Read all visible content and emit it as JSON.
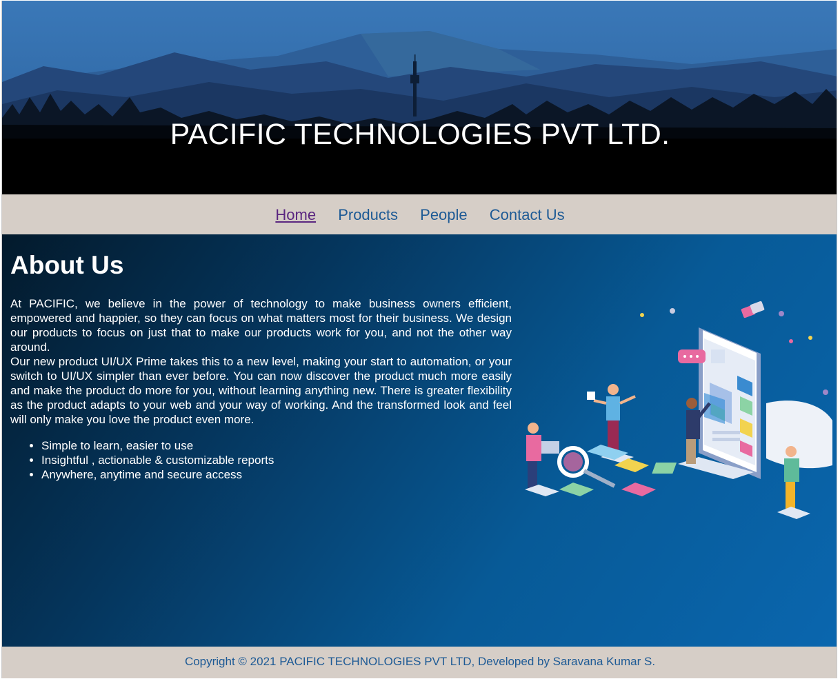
{
  "header": {
    "title": "PACIFIC TECHNOLOGIES PVT LTD."
  },
  "nav": {
    "items": [
      {
        "label": "Home",
        "active": true
      },
      {
        "label": "Products"
      },
      {
        "label": "People"
      },
      {
        "label": "Contact Us"
      }
    ]
  },
  "about": {
    "heading": "About Us",
    "paragraph1": "At PACIFIC, we believe in the power of technology to make business owners efficient, empowered and happier, so they can focus on what matters most for their business. We design our products to focus on just that to make our products work for you, and not the other way around.",
    "paragraph2": "Our new product UI/UX Prime takes this to a new level, making your start to automation, or your switch to UI/UX simpler than ever before. You can now discover the product much more easily and make the product do more for you, without learning anything new. There is greater flexibility as the product adapts to your web and your way of working. And the transformed look and feel will only make you love the product even more.",
    "features": [
      "Simple to learn, easier to use",
      "Insightful , actionable & customizable reports",
      "Anywhere, anytime and secure access"
    ]
  },
  "footer": {
    "text": "Copyright © 2021 PACIFIC TECHNOLOGIES PVT LTD, Developed by Saravana Kumar S."
  },
  "colors": {
    "nav_bg": "#d6cec7",
    "link": "#1d5a95",
    "visited_link": "#5a2680",
    "main_gradient_start": "#031a2c",
    "main_gradient_end": "#0a66ae"
  }
}
